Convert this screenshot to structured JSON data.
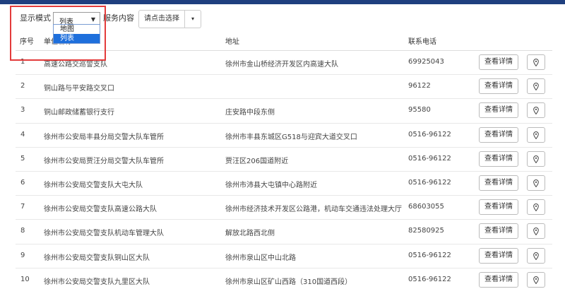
{
  "toolbar": {
    "display_mode_label": "显示模式",
    "display_mode_value": "列表",
    "display_mode_options": [
      "地图",
      "列表"
    ],
    "service_label": "服务内容",
    "service_button": "请点击选择",
    "caret": "▾"
  },
  "table": {
    "headers": {
      "index": "序号",
      "name": "单位名称",
      "address": "地址",
      "phone": "联系电话"
    },
    "detail_label": "查看详情",
    "rows": [
      {
        "index": "1",
        "name": "高速公路交巡警支队",
        "address": "徐州市金山桥经济开发区内高速大队",
        "phone": "69925043"
      },
      {
        "index": "2",
        "name": "铜山路与平安路交叉口",
        "address": "",
        "phone": "96122"
      },
      {
        "index": "3",
        "name": "铜山邮政储蓄银行支行",
        "address": "庄安路中段东侧",
        "phone": "95580"
      },
      {
        "index": "4",
        "name": "徐州市公安局丰县分局交警大队车管所",
        "address": "徐州市丰县东城区G518与迎宾大道交叉口",
        "phone": "0516-96122"
      },
      {
        "index": "5",
        "name": "徐州市公安局贾汪分局交警大队车管所",
        "address": "贾汪区206国道附近",
        "phone": "0516-96122"
      },
      {
        "index": "6",
        "name": "徐州市公安局交警支队大屯大队",
        "address": "徐州市沛县大屯镇中心路附近",
        "phone": "0516-96122"
      },
      {
        "index": "7",
        "name": "徐州市公安局交警支队高速公路大队",
        "address": "徐州市经济技术开发区公路港，机动车交通违法处理大厅",
        "phone": "68603055"
      },
      {
        "index": "8",
        "name": "徐州市公安局交警支队机动车管理大队",
        "address": "解放北路西北侧",
        "phone": "82580925"
      },
      {
        "index": "9",
        "name": "徐州市公安局交警支队铜山区大队",
        "address": "徐州市泉山区中山北路",
        "phone": "0516-96122"
      },
      {
        "index": "10",
        "name": "徐州市公安局交警支队九里区大队",
        "address": "徐州市泉山区矿山西路（310国道西段）",
        "phone": "0516-96122"
      }
    ]
  },
  "icons": {
    "location": "map-pin-icon",
    "dropdown": "chevron-down-icon"
  },
  "colors": {
    "topbar": "#1f3f7f",
    "highlight": "#e33b3b",
    "selected_option": "#1e6fdc"
  }
}
